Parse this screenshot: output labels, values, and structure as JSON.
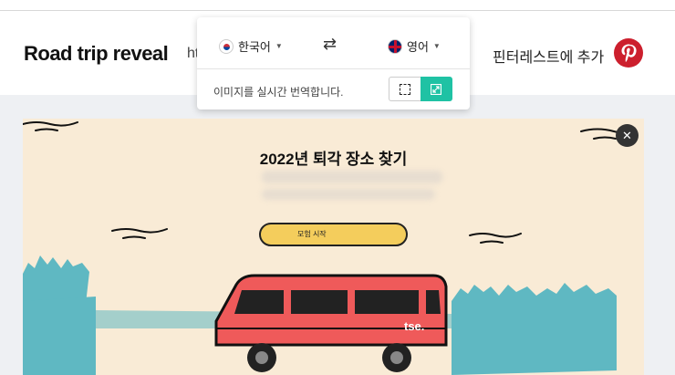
{
  "page": {
    "title": "Road trip reveal",
    "url_fragment": "ht",
    "pin_label": "핀터레스트에 추가",
    "pin_icon": "pinterest-icon",
    "close_icon": "close-icon"
  },
  "translator": {
    "source_language": "한국어",
    "target_language": "영어",
    "swap_icon": "swap-arrows-icon",
    "live_label": "이미지를 실시간 번역합니다.",
    "select_area_icon": "select-area-icon",
    "fullscreen_icon": "fullscreen-icon",
    "accent": "#1fc2a4"
  },
  "content": {
    "headline": "2022년 퇴각 장소 찾기",
    "cta_label": "모험 시작",
    "van_logo": "tse."
  },
  "colors": {
    "background": "#f9ebd6",
    "van_red": "#ef5a5a",
    "trees": "#5fb8c2",
    "cta_yellow": "#f4cd5c"
  }
}
